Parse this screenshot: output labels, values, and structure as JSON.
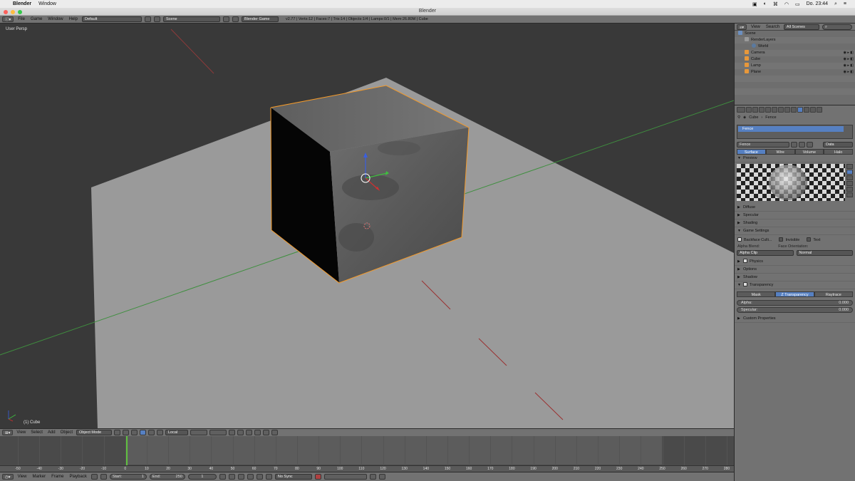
{
  "mac": {
    "app": "Blender",
    "menu": [
      "Window"
    ],
    "clock": "Do. 23:44"
  },
  "window_title": "Blender",
  "info": {
    "menus": [
      "File",
      "Game",
      "Window",
      "Help"
    ],
    "layout": "Default",
    "scene": "Scene",
    "engine": "Blender Game",
    "stats": "v2.77 | Verts:12 | Faces:7 | Tris:14 | Objects:1/4 | Lamps:0/1 | Mem:26.80M | Cube"
  },
  "viewport": {
    "view_label": "User Persp",
    "object_label": "(1) Cube"
  },
  "view_header": {
    "menus": [
      "View",
      "Select",
      "Add",
      "Object"
    ],
    "mode": "Object Mode",
    "pivot": "Local"
  },
  "timeline": {
    "ticks": [
      "-50",
      "-40",
      "-30",
      "-20",
      "-10",
      "0",
      "10",
      "20",
      "30",
      "40",
      "50",
      "60",
      "70",
      "80",
      "90",
      "100",
      "110",
      "120",
      "130",
      "140",
      "150",
      "160",
      "170",
      "180",
      "190",
      "200",
      "210",
      "220",
      "230",
      "240",
      "250",
      "260",
      "270",
      "280"
    ],
    "menus": [
      "View",
      "Marker",
      "Frame",
      "Playback"
    ],
    "start_label": "Start:",
    "start": "1",
    "end_label": "End:",
    "end": "250",
    "current": "1",
    "sync": "No Sync"
  },
  "outliner": {
    "menus": [
      "View",
      "Search"
    ],
    "filter": "All Scenes",
    "items": [
      "Scene",
      "RenderLayers",
      "World",
      "Camera",
      "Cube",
      "Lamp",
      "Plane"
    ]
  },
  "properties": {
    "crumb_object": "Cube",
    "crumb_material": "Fence",
    "slot": "Fence",
    "material_name": "Fence",
    "data_dropdown": "Data",
    "type_tabs": [
      "Surface",
      "Wire",
      "Volume",
      "Halo"
    ],
    "preview_label": "Preview",
    "sections": [
      "Diffuse",
      "Specular",
      "Shading",
      "Game Settings"
    ],
    "backface": "Backface Culli...",
    "invisible": "Invisible",
    "text": "Text",
    "alpha_blend_label": "Alpha Blend:",
    "face_orient_label": "Face Orientation:",
    "alpha_blend": "Alpha Clip",
    "face_orient": "Normal",
    "sections2": [
      "Physics",
      "Options",
      "Shadow",
      "Transparency"
    ],
    "transp_tabs": [
      "Mask",
      "Z Transparency",
      "Raytrace"
    ],
    "alpha_label": "Alpha:",
    "alpha": "0.000",
    "specular_label": "Specular:",
    "specular": "0.000",
    "custom": "Custom Properties"
  }
}
